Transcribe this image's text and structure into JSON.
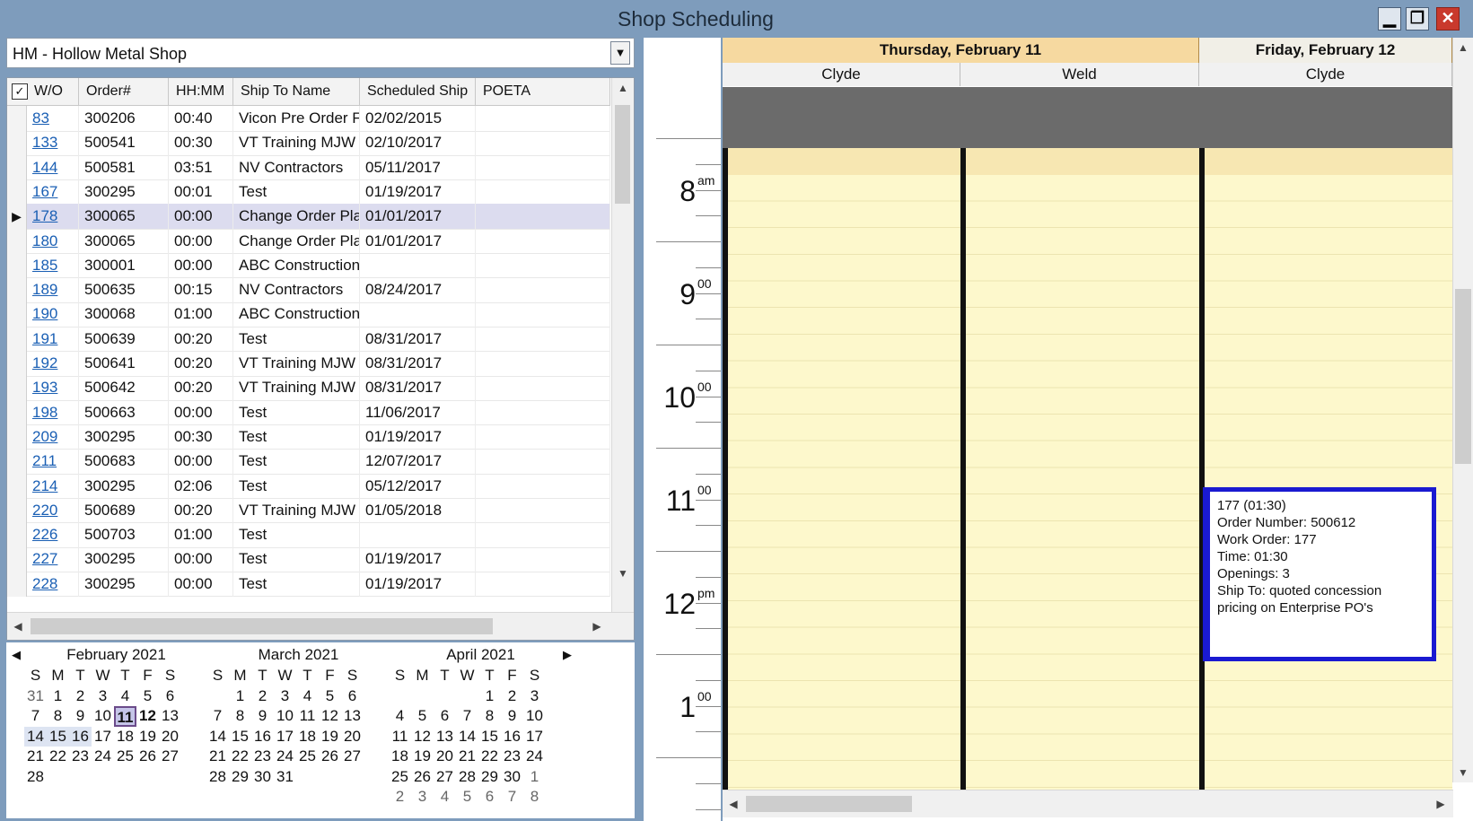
{
  "window": {
    "title": "Shop Scheduling",
    "minimize": "▁",
    "maximize": "❐",
    "close": "✕"
  },
  "shop_select": {
    "value": "HM - Hollow Metal Shop"
  },
  "grid": {
    "columns": [
      "W/O",
      "Order#",
      "HH:MM",
      "Ship To Name",
      "Scheduled Ship",
      "POETA"
    ],
    "rows": [
      {
        "wo": "83",
        "order": "300206",
        "hhmm": "00:40",
        "ship_to": "Vicon Pre Order F",
        "sched": "02/02/2015",
        "poeta": ""
      },
      {
        "wo": "133",
        "order": "500541",
        "hhmm": "00:30",
        "ship_to": "VT Training MJW",
        "sched": "02/10/2017",
        "poeta": ""
      },
      {
        "wo": "144",
        "order": "500581",
        "hhmm": "03:51",
        "ship_to": "NV Contractors",
        "sched": "05/11/2017",
        "poeta": ""
      },
      {
        "wo": "167",
        "order": "300295",
        "hhmm": "00:01",
        "ship_to": "Test",
        "sched": "01/19/2017",
        "poeta": ""
      },
      {
        "wo": "178",
        "order": "300065",
        "hhmm": "00:00",
        "ship_to": "Change Order Pla",
        "sched": "01/01/2017",
        "poeta": "",
        "selected": true
      },
      {
        "wo": "180",
        "order": "300065",
        "hhmm": "00:00",
        "ship_to": "Change Order Pla",
        "sched": "01/01/2017",
        "poeta": ""
      },
      {
        "wo": "185",
        "order": "300001",
        "hhmm": "00:00",
        "ship_to": "ABC Construction",
        "sched": "",
        "poeta": ""
      },
      {
        "wo": "189",
        "order": "500635",
        "hhmm": "00:15",
        "ship_to": "NV Contractors",
        "sched": "08/24/2017",
        "poeta": ""
      },
      {
        "wo": "190",
        "order": "300068",
        "hhmm": "01:00",
        "ship_to": "ABC Construction",
        "sched": "",
        "poeta": ""
      },
      {
        "wo": "191",
        "order": "500639",
        "hhmm": "00:20",
        "ship_to": "Test",
        "sched": "08/31/2017",
        "poeta": ""
      },
      {
        "wo": "192",
        "order": "500641",
        "hhmm": "00:20",
        "ship_to": "VT Training MJW",
        "sched": "08/31/2017",
        "poeta": ""
      },
      {
        "wo": "193",
        "order": "500642",
        "hhmm": "00:20",
        "ship_to": "VT Training MJW",
        "sched": "08/31/2017",
        "poeta": ""
      },
      {
        "wo": "198",
        "order": "500663",
        "hhmm": "00:00",
        "ship_to": "Test",
        "sched": "11/06/2017",
        "poeta": ""
      },
      {
        "wo": "209",
        "order": "300295",
        "hhmm": "00:30",
        "ship_to": "Test",
        "sched": "01/19/2017",
        "poeta": ""
      },
      {
        "wo": "211",
        "order": "500683",
        "hhmm": "00:00",
        "ship_to": "Test",
        "sched": "12/07/2017",
        "poeta": ""
      },
      {
        "wo": "214",
        "order": "300295",
        "hhmm": "02:06",
        "ship_to": "Test",
        "sched": "05/12/2017",
        "poeta": ""
      },
      {
        "wo": "220",
        "order": "500689",
        "hhmm": "00:20",
        "ship_to": "VT Training MJW",
        "sched": "01/05/2018",
        "poeta": ""
      },
      {
        "wo": "226",
        "order": "500703",
        "hhmm": "01:00",
        "ship_to": "Test",
        "sched": "",
        "poeta": ""
      },
      {
        "wo": "227",
        "order": "300295",
        "hhmm": "00:00",
        "ship_to": "Test",
        "sched": "01/19/2017",
        "poeta": ""
      },
      {
        "wo": "228",
        "order": "300295",
        "hhmm": "00:00",
        "ship_to": "Test",
        "sched": "01/19/2017",
        "poeta": ""
      }
    ]
  },
  "calendars": {
    "dow": [
      "S",
      "M",
      "T",
      "W",
      "T",
      "F",
      "S"
    ],
    "months": [
      {
        "title": "February 2021",
        "weeks": [
          [
            "31",
            "1",
            "2",
            "3",
            "4",
            "5",
            "6"
          ],
          [
            "7",
            "8",
            "9",
            "10",
            "11",
            "12",
            "13"
          ],
          [
            "14",
            "15",
            "16",
            "17",
            "18",
            "19",
            "20"
          ],
          [
            "21",
            "22",
            "23",
            "24",
            "25",
            "26",
            "27"
          ],
          [
            "28",
            "",
            "",
            "",
            "",
            "",
            ""
          ]
        ]
      },
      {
        "title": "March 2021",
        "weeks": [
          [
            "",
            "1",
            "2",
            "3",
            "4",
            "5",
            "6"
          ],
          [
            "7",
            "8",
            "9",
            "10",
            "11",
            "12",
            "13"
          ],
          [
            "14",
            "15",
            "16",
            "17",
            "18",
            "19",
            "20"
          ],
          [
            "21",
            "22",
            "23",
            "24",
            "25",
            "26",
            "27"
          ],
          [
            "28",
            "29",
            "30",
            "31",
            "",
            "",
            ""
          ]
        ]
      },
      {
        "title": "April 2021",
        "weeks": [
          [
            "",
            "",
            "",
            "",
            "1",
            "2",
            "3"
          ],
          [
            "4",
            "5",
            "6",
            "7",
            "8",
            "9",
            "10"
          ],
          [
            "11",
            "12",
            "13",
            "14",
            "15",
            "16",
            "17"
          ],
          [
            "18",
            "19",
            "20",
            "21",
            "22",
            "23",
            "24"
          ],
          [
            "25",
            "26",
            "27",
            "28",
            "29",
            "30",
            "1"
          ],
          [
            "2",
            "3",
            "4",
            "5",
            "6",
            "7",
            "8"
          ]
        ]
      }
    ]
  },
  "ruler": [
    {
      "h": "8",
      "m": "am"
    },
    {
      "h": "9",
      "m": "00"
    },
    {
      "h": "10",
      "m": "00"
    },
    {
      "h": "11",
      "m": "00"
    },
    {
      "h": "12",
      "m": "pm"
    },
    {
      "h": "1",
      "m": "00"
    }
  ],
  "schedule": {
    "days": [
      "Thursday, February 11",
      "Friday, February 12"
    ],
    "resources": [
      "Clyde",
      "Weld",
      "Clyde"
    ]
  },
  "appointment": {
    "title": "177 (01:30)",
    "order": "Order Number: 500612",
    "work_order": "Work Order: 177",
    "time": "Time: 01:30",
    "openings": "Openings: 3",
    "ship_to": "Ship To: quoted concession pricing on Enterprise PO's"
  }
}
